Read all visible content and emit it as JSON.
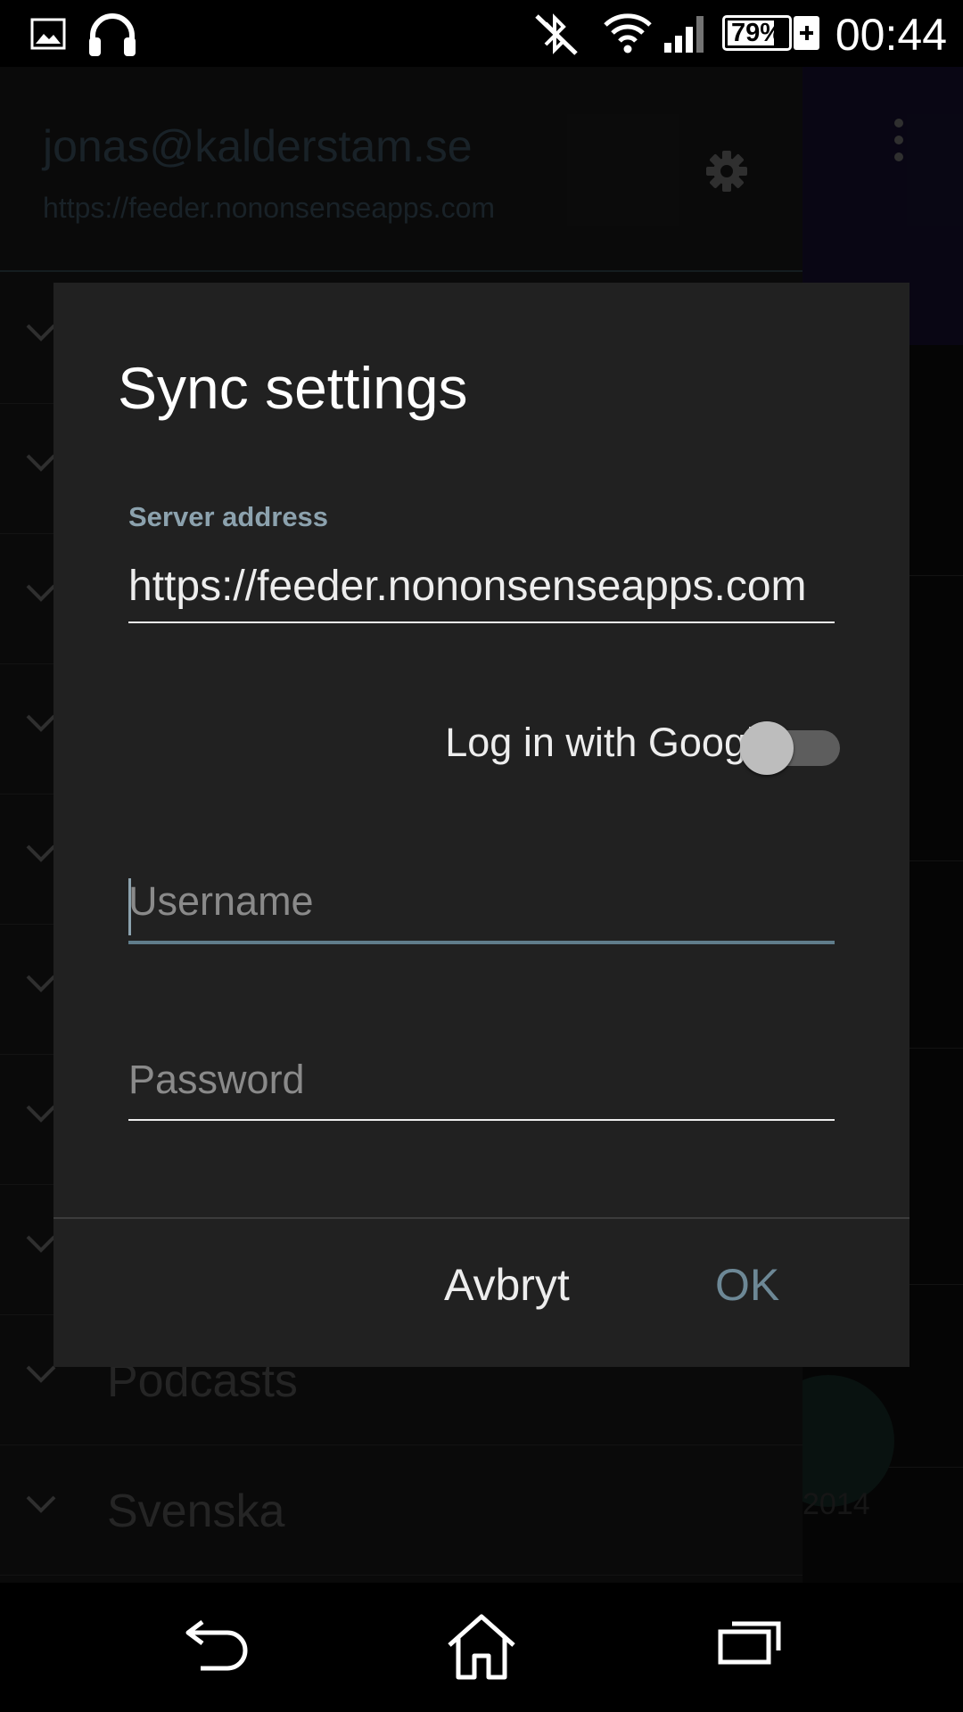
{
  "status_bar": {
    "time": "00:44",
    "battery_percent": "79%",
    "battery_level": 0.79,
    "icons": [
      "image-icon",
      "headphones-icon",
      "bluetooth-off-icon",
      "wifi-icon",
      "signal-icon",
      "battery-icon",
      "charging-icon"
    ]
  },
  "drawer": {
    "email": "jonas@kalderstam.se",
    "server": "https://feeder.nononsenseapps.com",
    "items": [
      {
        "label": ""
      },
      {
        "label": ""
      },
      {
        "label": ""
      },
      {
        "label": ""
      },
      {
        "label": ""
      },
      {
        "label": ""
      },
      {
        "label": ""
      },
      {
        "label": ""
      },
      {
        "label": "Podcasts"
      },
      {
        "label": "Svenska"
      }
    ]
  },
  "background": {
    "date_fragment": "2014"
  },
  "dialog": {
    "title": "Sync settings",
    "server_label": "Server address",
    "server_value": "https://feeder.nononsenseapps.com",
    "google_label": "Log in with Google",
    "google_enabled": false,
    "username_placeholder": "Username",
    "password_placeholder": "Password",
    "cancel_label": "Avbryt",
    "ok_label": "OK"
  },
  "colors": {
    "accent": "#607d8b",
    "dialog_bg": "#212121",
    "ok_text": "#6d8896"
  }
}
